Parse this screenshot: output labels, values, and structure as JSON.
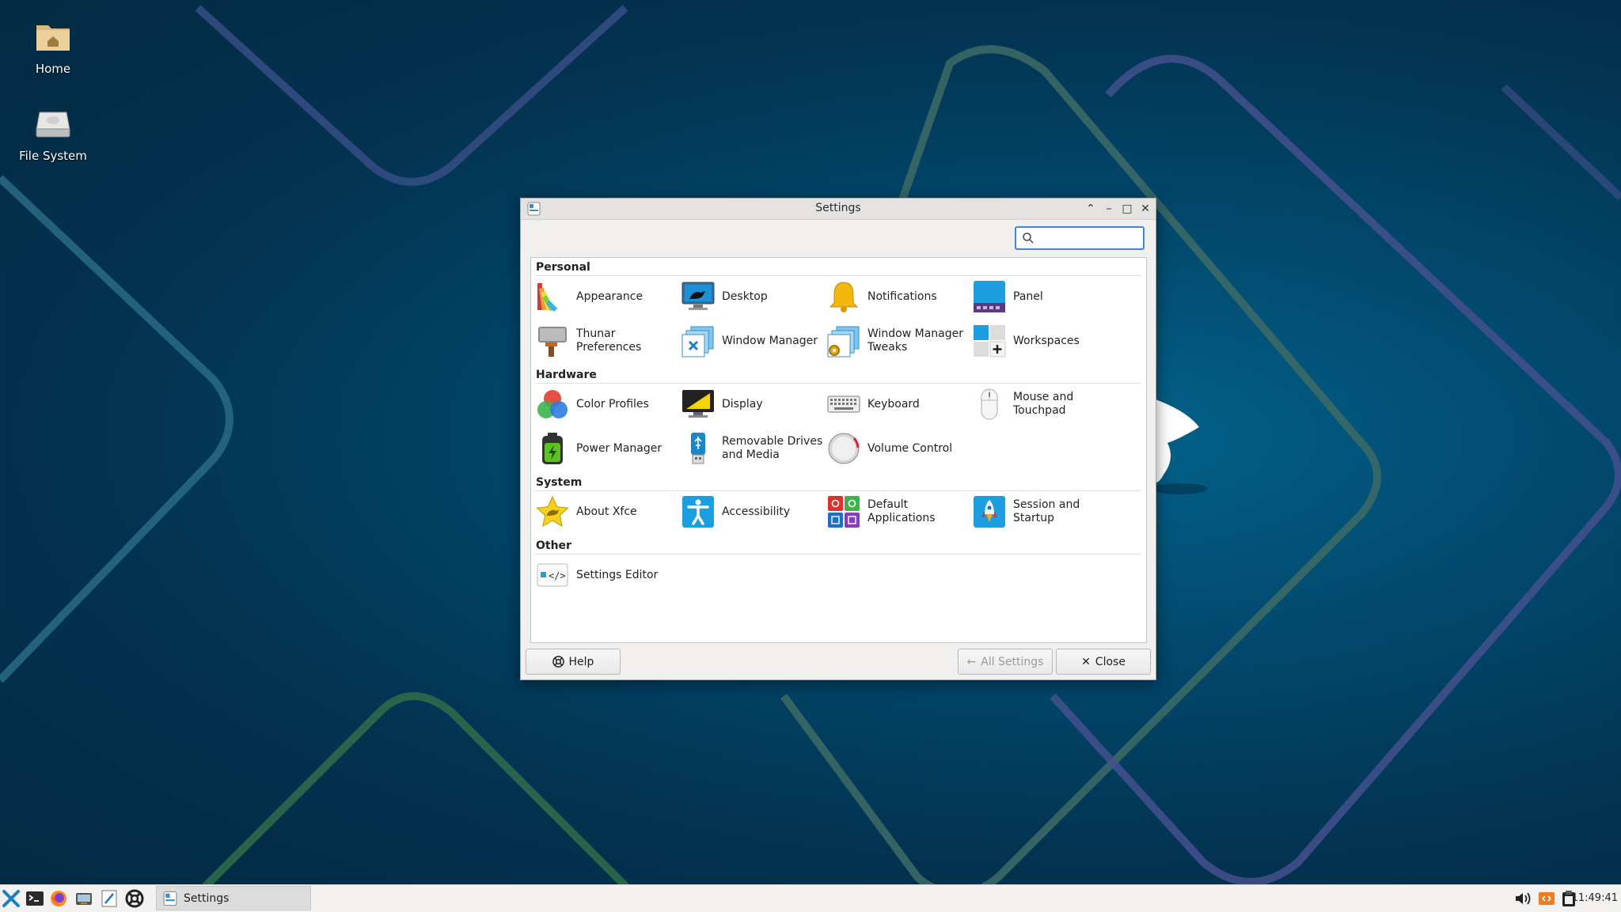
{
  "desktop": {
    "icons": [
      {
        "label": "Home"
      },
      {
        "label": "File System"
      }
    ]
  },
  "window": {
    "title": "Settings",
    "search": {
      "value": "",
      "placeholder": ""
    },
    "sections": [
      {
        "title": "Personal",
        "items": [
          {
            "label": "Appearance",
            "icon": "appearance-icon"
          },
          {
            "label": "Desktop",
            "icon": "desktop-icon"
          },
          {
            "label": "Notifications",
            "icon": "bell-icon"
          },
          {
            "label": "Panel",
            "icon": "panel-icon"
          },
          {
            "label": "Thunar Preferences",
            "icon": "thunar-icon"
          },
          {
            "label": "Window Manager",
            "icon": "window-manager-icon"
          },
          {
            "label": "Window Manager Tweaks",
            "icon": "wm-tweaks-icon"
          },
          {
            "label": "Workspaces",
            "icon": "workspaces-icon"
          }
        ]
      },
      {
        "title": "Hardware",
        "items": [
          {
            "label": "Color Profiles",
            "icon": "color-profiles-icon"
          },
          {
            "label": "Display",
            "icon": "display-icon"
          },
          {
            "label": "Keyboard",
            "icon": "keyboard-icon"
          },
          {
            "label": "Mouse and Touchpad",
            "icon": "mouse-icon"
          },
          {
            "label": "Power Manager",
            "icon": "battery-icon"
          },
          {
            "label": "Removable Drives and Media",
            "icon": "usb-drive-icon"
          },
          {
            "label": "Volume Control",
            "icon": "volume-knob-icon"
          }
        ]
      },
      {
        "title": "System",
        "items": [
          {
            "label": "About Xfce",
            "icon": "star-icon"
          },
          {
            "label": "Accessibility",
            "icon": "accessibility-icon"
          },
          {
            "label": "Default Applications",
            "icon": "default-apps-icon"
          },
          {
            "label": "Session and Startup",
            "icon": "rocket-icon"
          }
        ]
      },
      {
        "title": "Other",
        "items": [
          {
            "label": "Settings Editor",
            "icon": "code-icon"
          }
        ]
      }
    ],
    "buttons": {
      "help": "Help",
      "all_settings": "All Settings",
      "close": "Close"
    }
  },
  "taskbar": {
    "task_label": "Settings",
    "clock": "11:49:41"
  },
  "colors": {
    "accent": "#3d88d8",
    "desktop_bg": "#02466a"
  }
}
